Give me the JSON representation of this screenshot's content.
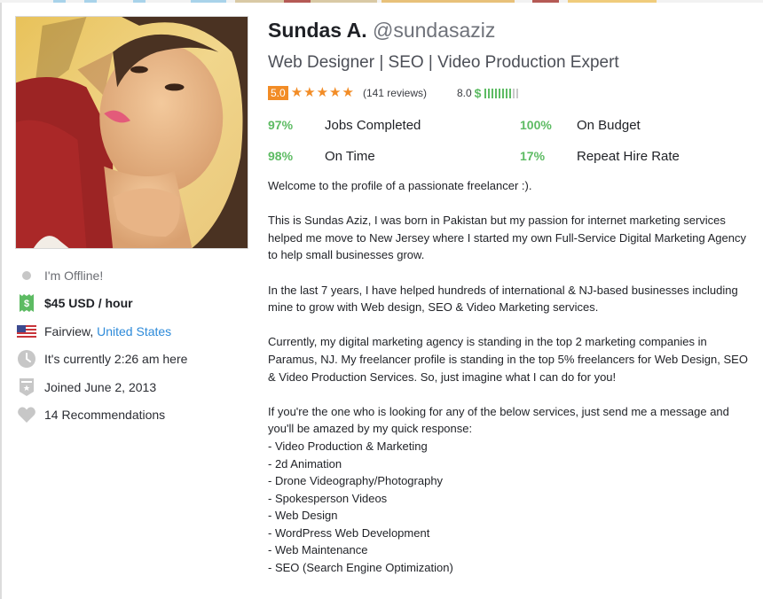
{
  "profile": {
    "display_name": "Sundas A.",
    "username": "@sundasaziz",
    "tagline": "Web Designer | SEO | Video Production Expert",
    "photo_alt": "Profile photo of Sundas A."
  },
  "rating": {
    "score": "5.0",
    "stars": 5,
    "stars_max": 5,
    "reviews": "(141 reviews)",
    "earnings_score": "8.0",
    "earnings_symbol": "$",
    "earnings_level": 8,
    "earnings_max": 10
  },
  "colors": {
    "accent_orange": "#f28c26",
    "success_green": "#5dbb63",
    "link_blue": "#2d8ad9",
    "muted_gray": "#c7c7c7"
  },
  "stats": [
    {
      "value": "97%",
      "label": "Jobs Completed"
    },
    {
      "value": "100%",
      "label": "On Budget"
    },
    {
      "value": "98%",
      "label": "On Time"
    },
    {
      "value": "17%",
      "label": "Repeat Hire Rate"
    }
  ],
  "sidebar": {
    "status": {
      "icon": "status-dot-icon",
      "text": "I'm Offline!"
    },
    "hourly_rate": {
      "icon": "dollar-ticket-icon",
      "text": "$45 USD / hour"
    },
    "location": {
      "icon": "us-flag-icon",
      "city": "Fairview, ",
      "country": "United States"
    },
    "local_time": {
      "icon": "clock-icon",
      "text": "It's currently 2:26 am here"
    },
    "joined": {
      "icon": "badge-icon",
      "text": "Joined June 2, 2013"
    },
    "recommendations": {
      "icon": "heart-icon",
      "text": "14 Recommendations"
    }
  },
  "about": {
    "paragraphs": [
      "Welcome to the profile of a passionate freelancer :).",
      "This is Sundas Aziz, I was born in Pakistan but my passion for internet marketing services helped me move to New Jersey where I started my own Full-Service Digital Marketing Agency to help small businesses grow.",
      "In the last 7 years, I have helped hundreds of international & NJ-based businesses including mine to grow with Web design, SEO & Video Marketing services.",
      "Currently, my digital marketing agency is standing in the top 2 marketing companies in Paramus, NJ. My freelancer profile is standing in the top 5% freelancers for Web Design, SEO & Video Production Services. So, just imagine what I can do for you!"
    ],
    "services_intro": "If you're the one who is looking for any of the below services, just send me a message and you'll be amazed by my quick response:",
    "services": [
      "- Video Production & Marketing",
      "- 2d Animation",
      "- Drone Videography/Photography",
      "- Spokesperson Videos",
      "- Web Design",
      "- WordPress Web Development",
      "- Web Maintenance",
      "- SEO (Search Engine Optimization)"
    ]
  }
}
